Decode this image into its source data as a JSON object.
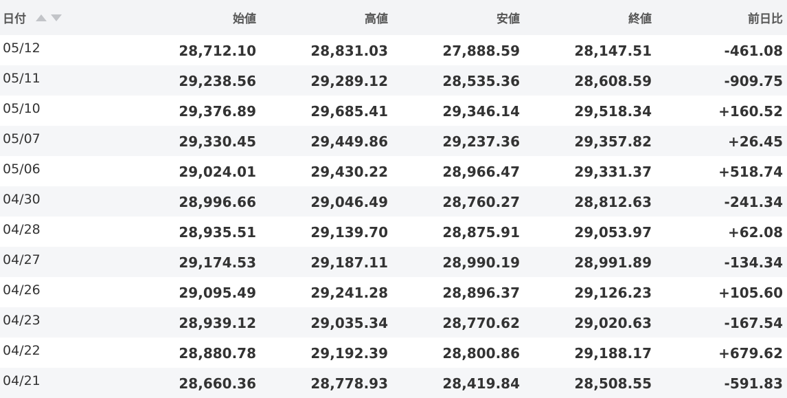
{
  "table": {
    "headers": {
      "date": "日付",
      "open": "始値",
      "high": "高値",
      "low": "安値",
      "close": "終値",
      "change": "前日比"
    },
    "sort_icons": [
      "sort-ascending-icon",
      "sort-descending-icon"
    ],
    "colors": {
      "positive": "#e8141a",
      "negative": "#1a6fd4",
      "header_bg": "#f3f4f6",
      "row_alt_bg": "#f5f6f8"
    },
    "rows": [
      {
        "date": "05/12",
        "open": "28,712.10",
        "high": "28,831.03",
        "low": "27,888.59",
        "close": "28,147.51",
        "change": "-461.08"
      },
      {
        "date": "05/11",
        "open": "29,238.56",
        "high": "29,289.12",
        "low": "28,535.36",
        "close": "28,608.59",
        "change": "-909.75"
      },
      {
        "date": "05/10",
        "open": "29,376.89",
        "high": "29,685.41",
        "low": "29,346.14",
        "close": "29,518.34",
        "change": "+160.52"
      },
      {
        "date": "05/07",
        "open": "29,330.45",
        "high": "29,449.86",
        "low": "29,237.36",
        "close": "29,357.82",
        "change": "+26.45"
      },
      {
        "date": "05/06",
        "open": "29,024.01",
        "high": "29,430.22",
        "low": "28,966.47",
        "close": "29,331.37",
        "change": "+518.74"
      },
      {
        "date": "04/30",
        "open": "28,996.66",
        "high": "29,046.49",
        "low": "28,760.27",
        "close": "28,812.63",
        "change": "-241.34"
      },
      {
        "date": "04/28",
        "open": "28,935.51",
        "high": "29,139.70",
        "low": "28,875.91",
        "close": "29,053.97",
        "change": "+62.08"
      },
      {
        "date": "04/27",
        "open": "29,174.53",
        "high": "29,187.11",
        "low": "28,990.19",
        "close": "28,991.89",
        "change": "-134.34"
      },
      {
        "date": "04/26",
        "open": "29,095.49",
        "high": "29,241.28",
        "low": "28,896.37",
        "close": "29,126.23",
        "change": "+105.60"
      },
      {
        "date": "04/23",
        "open": "28,939.12",
        "high": "29,035.34",
        "low": "28,770.62",
        "close": "29,020.63",
        "change": "-167.54"
      },
      {
        "date": "04/22",
        "open": "28,880.78",
        "high": "29,192.39",
        "low": "28,800.86",
        "close": "29,188.17",
        "change": "+679.62"
      },
      {
        "date": "04/21",
        "open": "28,660.36",
        "high": "28,778.93",
        "low": "28,419.84",
        "close": "28,508.55",
        "change": "-591.83"
      }
    ]
  }
}
